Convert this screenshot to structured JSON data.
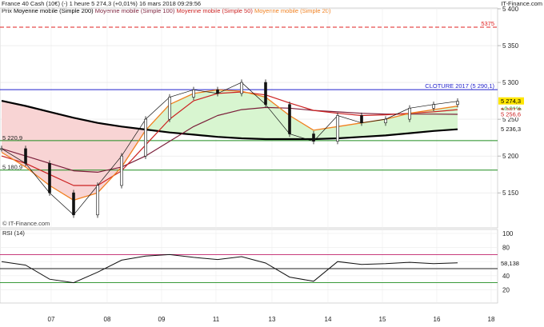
{
  "header": {
    "instrument": "France 40 Cash (10€) (-)",
    "timeframe": "1 heure",
    "last": "5 274,3 (+0,01%)",
    "datetime": "16 mars 2018 09:29:56",
    "brand": "IT-Finance.com",
    "legend_price": "Prix",
    "legend_ma200": "Moyenne mobile (Simple 200)",
    "legend_ma100": "Moyenne mobile (Simple 100)",
    "legend_ma50": "Moyenne mobile (Simple 50)",
    "legend_ma20": "Moyenne mobile (Simple 20)",
    "copyright": "© IT-Finance.com"
  },
  "colors": {
    "ma200": "#000000",
    "ma100": "#7b1f3a",
    "ma50": "#cc2222",
    "ma20": "#f08020",
    "cloture": "#2222cc",
    "resistance": "#e02020",
    "support": "#1e8c1e",
    "fill_bull": "#d8f5d0",
    "fill_bear": "#f8d4d4",
    "tag_price": "#ffe600",
    "tag_pct": "#1e9c1e"
  },
  "price_chart": {
    "yticks": [
      "5 400",
      "5 350",
      "5 300",
      "5 250",
      "5 200",
      "5 150"
    ],
    "ytick_values": [
      5400,
      5350,
      5300,
      5250,
      5200,
      5150
    ],
    "xticks": [
      "07",
      "08",
      "09",
      "11",
      "13",
      "14",
      "15",
      "16",
      "18"
    ],
    "cloture_label": "CLOTURE 2017 (5 290,1)",
    "cloture_value": 5290.1,
    "resistance_label": "5375",
    "resistance_value": 5375,
    "tag_price": "5 274,3",
    "tag_pct": "+0,01%",
    "tag_ma50": "5 267,8",
    "tag_ma100": "5 256,6",
    "tag_ma200": "5 236,3",
    "left_label_1": "5 220,9",
    "left_label_2": "5 180,9",
    "support_values": [
      5220.9,
      5180.9
    ]
  },
  "rsi_chart": {
    "title": "RSI (14)",
    "yticks": [
      "100",
      "80",
      "60",
      "40",
      "20"
    ],
    "ytick_values": [
      100,
      80,
      60,
      40,
      20
    ],
    "levels": [
      70,
      50,
      30
    ],
    "last_label": "58,138",
    "last_value": 58.138
  },
  "chart_data": {
    "type": "line",
    "title": "France 40 Cash (10€) (-) 1 heure",
    "x": [
      "07",
      "08",
      "09",
      "11",
      "13",
      "14",
      "15",
      "16",
      "18"
    ],
    "ylim": [
      5110,
      5400
    ],
    "grid": true,
    "legend": "top-left",
    "series": [
      {
        "name": "Prix",
        "values": [
          5210,
          5190,
          5150,
          5120,
          5160,
          5200,
          5250,
          5280,
          5290,
          5285,
          5300,
          5270,
          5230,
          5220,
          5255,
          5245,
          5250,
          5265,
          5270,
          5274.3
        ]
      },
      {
        "name": "Moyenne mobile (Simple 20)",
        "values": [
          5205,
          5185,
          5160,
          5140,
          5150,
          5185,
          5235,
          5270,
          5285,
          5290,
          5288,
          5280,
          5255,
          5235,
          5240,
          5245,
          5250,
          5258,
          5263,
          5267.8
        ]
      },
      {
        "name": "Moyenne mobile (Simple 50)",
        "values": [
          5200,
          5190,
          5175,
          5160,
          5160,
          5180,
          5215,
          5250,
          5275,
          5285,
          5287,
          5283,
          5272,
          5262,
          5258,
          5255,
          5256,
          5258,
          5260,
          5263
        ]
      },
      {
        "name": "Moyenne mobile (Simple 100)",
        "values": [
          5210,
          5200,
          5190,
          5180,
          5178,
          5185,
          5200,
          5220,
          5240,
          5255,
          5263,
          5266,
          5265,
          5262,
          5260,
          5258,
          5257,
          5257,
          5257,
          5256.6
        ]
      },
      {
        "name": "Moyenne mobile (Simple 200)",
        "values": [
          5275,
          5268,
          5260,
          5252,
          5245,
          5240,
          5236,
          5232,
          5229,
          5226,
          5224,
          5223,
          5223,
          5223,
          5224,
          5226,
          5228,
          5231,
          5234,
          5236.3
        ]
      },
      {
        "name": "RSI (14)",
        "values": [
          60,
          55,
          35,
          30,
          45,
          62,
          68,
          70,
          66,
          63,
          67,
          58,
          38,
          32,
          60,
          56,
          57,
          59,
          57,
          58.138
        ]
      }
    ]
  }
}
